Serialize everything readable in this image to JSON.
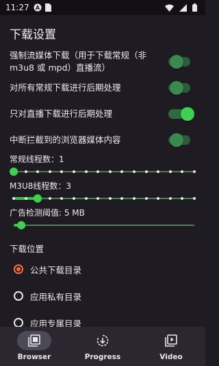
{
  "status_bar": {
    "time": "11:27",
    "icons": [
      "notification-a-icon",
      "sim-card-icon",
      "wifi-icon",
      "signal-icon",
      "battery-icon"
    ],
    "notification_letter": "A"
  },
  "page_title": "下载设置",
  "toggles": [
    {
      "label": "强制流媒体下载（用于下载常规（非 m3u8 或 mpd）直播流）",
      "state": "off"
    },
    {
      "label": "对所有常规下载进行后期处理",
      "state": "off"
    },
    {
      "label": "只对直播下载进行后期处理",
      "state": "on"
    },
    {
      "label": "中断拦截到的浏览器媒体内容",
      "state": "off"
    }
  ],
  "sliders": [
    {
      "label": "常规线程数：1",
      "value": 1,
      "min": 1,
      "max": 16
    },
    {
      "label": "M3U8线程数：3",
      "value": 3,
      "min": 1,
      "max": 16
    },
    {
      "label": "广告检测阈值: 5 MB",
      "value": 5,
      "min": 1,
      "max": 100
    }
  ],
  "download_location": {
    "title": "下载位置",
    "options": [
      {
        "label": "公共下载目录",
        "selected": true
      },
      {
        "label": "应用私有目录",
        "selected": false
      },
      {
        "label": "应用专属目录",
        "selected": false
      }
    ]
  },
  "bottom_nav": [
    {
      "label": "Browser",
      "icon": "browser-icon",
      "active": true
    },
    {
      "label": "Progress",
      "icon": "progress-icon",
      "active": false
    },
    {
      "label": "Video",
      "icon": "video-icon",
      "active": false
    }
  ],
  "colors": {
    "accent_green": "#3cd24f",
    "radio_selected": "#ff6b3d",
    "background": "#1e1c22",
    "nav_background": "#2a2730"
  }
}
